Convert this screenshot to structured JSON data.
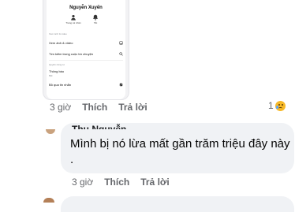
{
  "screenshot": {
    "profile_name": "Nguyễn Xuyến",
    "actions": [
      {
        "icon": "user-icon",
        "label": "Trang cá nhân"
      },
      {
        "icon": "bell-icon",
        "label": "Tắt"
      }
    ],
    "section_media": "Xem ảnh & video",
    "media_label": "Xem ảnh & video",
    "search_label": "Tìm kiếm trong cuộc trò chuyện",
    "section_privacy": "Quyền riêng tư",
    "notifications_label": "Thông báo",
    "notifications_sub": "Bật",
    "restrict_label": "Bỏ qua tin nhắn"
  },
  "comment1": {
    "time": "3 giờ",
    "like": "Thích",
    "reply": "Trả lời",
    "reaction_count": "1"
  },
  "comment2": {
    "author": "Thu Nguyễn",
    "text": "Mình bị nó lừa mất gần trăm triệu đây này .",
    "time": "3 giờ",
    "like": "Thích",
    "reply": "Trả lời"
  },
  "colors": {
    "bubble": "#f0f2f5",
    "meta": "#65676b",
    "text": "#050505"
  }
}
